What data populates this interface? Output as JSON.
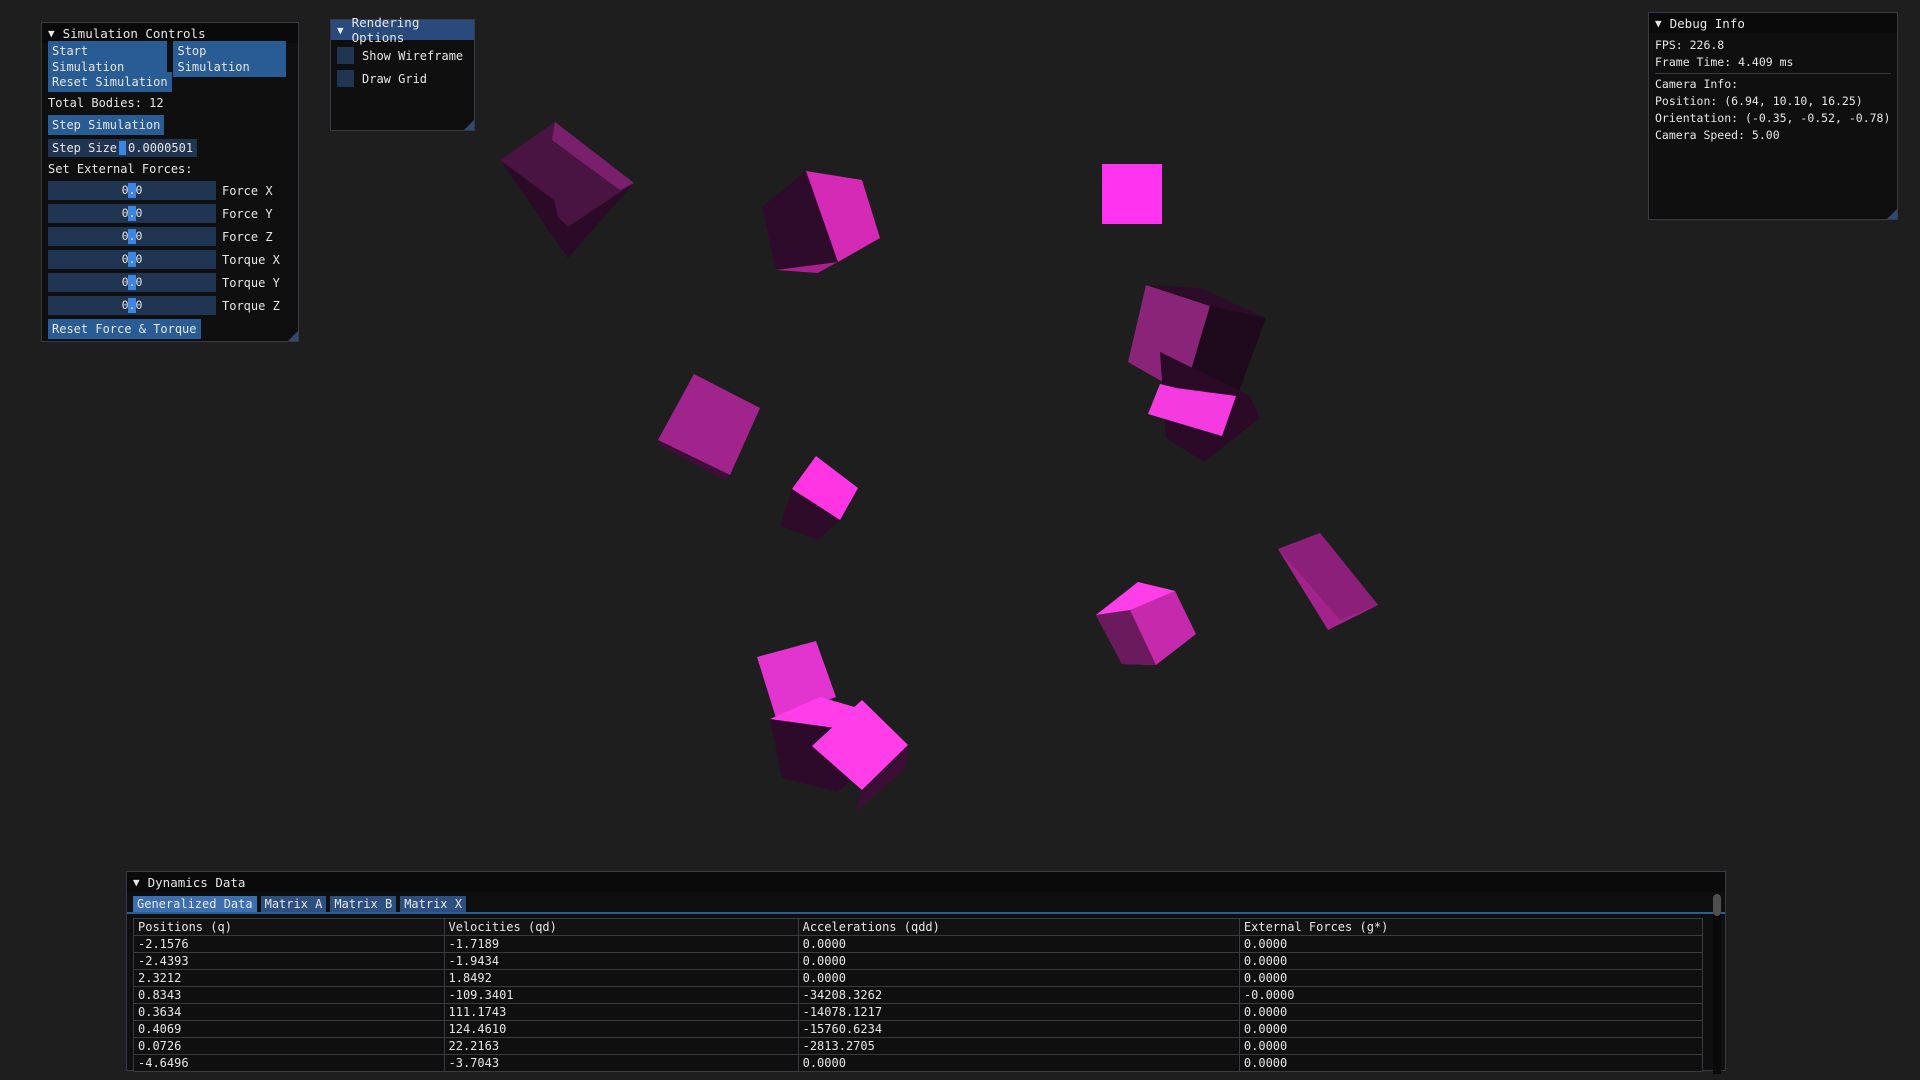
{
  "sim": {
    "title": "Simulation Controls",
    "start": "Start Simulation",
    "stop": "Stop Simulation",
    "reset": "Reset Simulation",
    "total_bodies": "Total Bodies: 12",
    "step": "Step Simulation",
    "step_size_label": "Step Size",
    "step_size_value": "0.0000501",
    "ext_forces_label": "Set External Forces:",
    "sliders": [
      {
        "label": "Force X",
        "value": "0.0"
      },
      {
        "label": "Force Y",
        "value": "0.0"
      },
      {
        "label": "Force Z",
        "value": "0.0"
      },
      {
        "label": "Torque X",
        "value": "0.0"
      },
      {
        "label": "Torque Y",
        "value": "0.0"
      },
      {
        "label": "Torque Z",
        "value": "0.0"
      }
    ],
    "reset_force": "Reset Force & Torque"
  },
  "render": {
    "title": "Rendering Options",
    "wireframe": "Show Wireframe",
    "grid": "Draw Grid"
  },
  "debug": {
    "title": "Debug Info",
    "fps": "FPS: 226.8",
    "frame_time": "Frame Time: 4.409 ms",
    "camera_info": "Camera Info:",
    "position": "Position: (6.94, 10.10, 16.25)",
    "orientation": "Orientation: (-0.35, -0.52, -0.78)",
    "speed": "Camera Speed: 5.00"
  },
  "dynamics": {
    "title": "Dynamics Data",
    "tabs": [
      "Generalized Data",
      "Matrix A",
      "Matrix B",
      "Matrix X"
    ],
    "headers": [
      "Positions (q)",
      "Velocities (qd)",
      "Accelerations (qdd)",
      "External Forces (g*)"
    ],
    "rows": [
      [
        "-2.1576",
        "-1.7189",
        "0.0000",
        "0.0000"
      ],
      [
        "-2.4393",
        "-1.9434",
        "0.0000",
        "0.0000"
      ],
      [
        "2.3212",
        "1.8492",
        "0.0000",
        "0.0000"
      ],
      [
        "0.8343",
        "-109.3401",
        "-34208.3262",
        "-0.0000"
      ],
      [
        "0.3634",
        "111.1743",
        "-14078.1217",
        "0.0000"
      ],
      [
        "0.4069",
        "124.4610",
        "-15760.6234",
        "0.0000"
      ],
      [
        "0.0726",
        "22.2163",
        "-2813.2705",
        "0.0000"
      ],
      [
        "-4.6496",
        "-3.7043",
        "0.0000",
        "0.0000"
      ]
    ]
  },
  "colors": {
    "bright": "#ff33ee",
    "mid": "#c42aa8",
    "dark": "#6a1a5c",
    "shadow": "#2a0a24"
  }
}
